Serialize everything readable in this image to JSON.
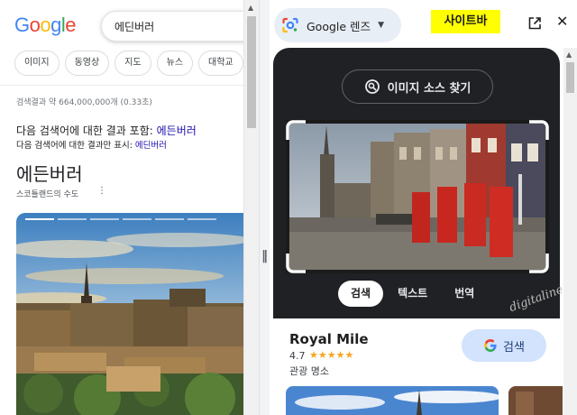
{
  "search": {
    "logo": [
      "G",
      "o",
      "o",
      "g",
      "l",
      "e"
    ],
    "logo_colors": [
      "#4285f4",
      "#ea4335",
      "#fbbc05",
      "#4285f4",
      "#34a853",
      "#ea4335"
    ],
    "query": "에딘버러",
    "chips": [
      "이미지",
      "동영상",
      "지도",
      "뉴스",
      "대학교"
    ],
    "result_stats": "검색결과 약 664,000,000개 (0.33초)",
    "spell_prefix": "다음 검색어에 대한 결과 포함: ",
    "spell_term": "에든버러",
    "spell2_prefix": "다음 검색어에 대한 결과만 표시: ",
    "spell2_term": "에딘버러",
    "kp_title": "에든버러",
    "kp_subtitle": "스코틀랜드의 수도",
    "kp_more": "⋮"
  },
  "lens": {
    "button_label": "Google 렌즈",
    "caret": "▼",
    "annotation_tag": "사이트바",
    "close": "✕",
    "source_button": "이미지 소스 찾기",
    "modes": [
      "검색",
      "텍스트",
      "번역"
    ],
    "watermark": "digitaline",
    "result": {
      "title": "Royal Mile",
      "rating": "4.7",
      "stars": "★★★★★",
      "category": "관광 명소",
      "search_button": "검색"
    }
  },
  "splitter": {
    "grip": "‖"
  },
  "colors": {
    "lens_dark": "#202124",
    "accent_blue": "#1a0dab",
    "highlight": "#ffff00",
    "search_button_bg": "#d3e3fd"
  }
}
